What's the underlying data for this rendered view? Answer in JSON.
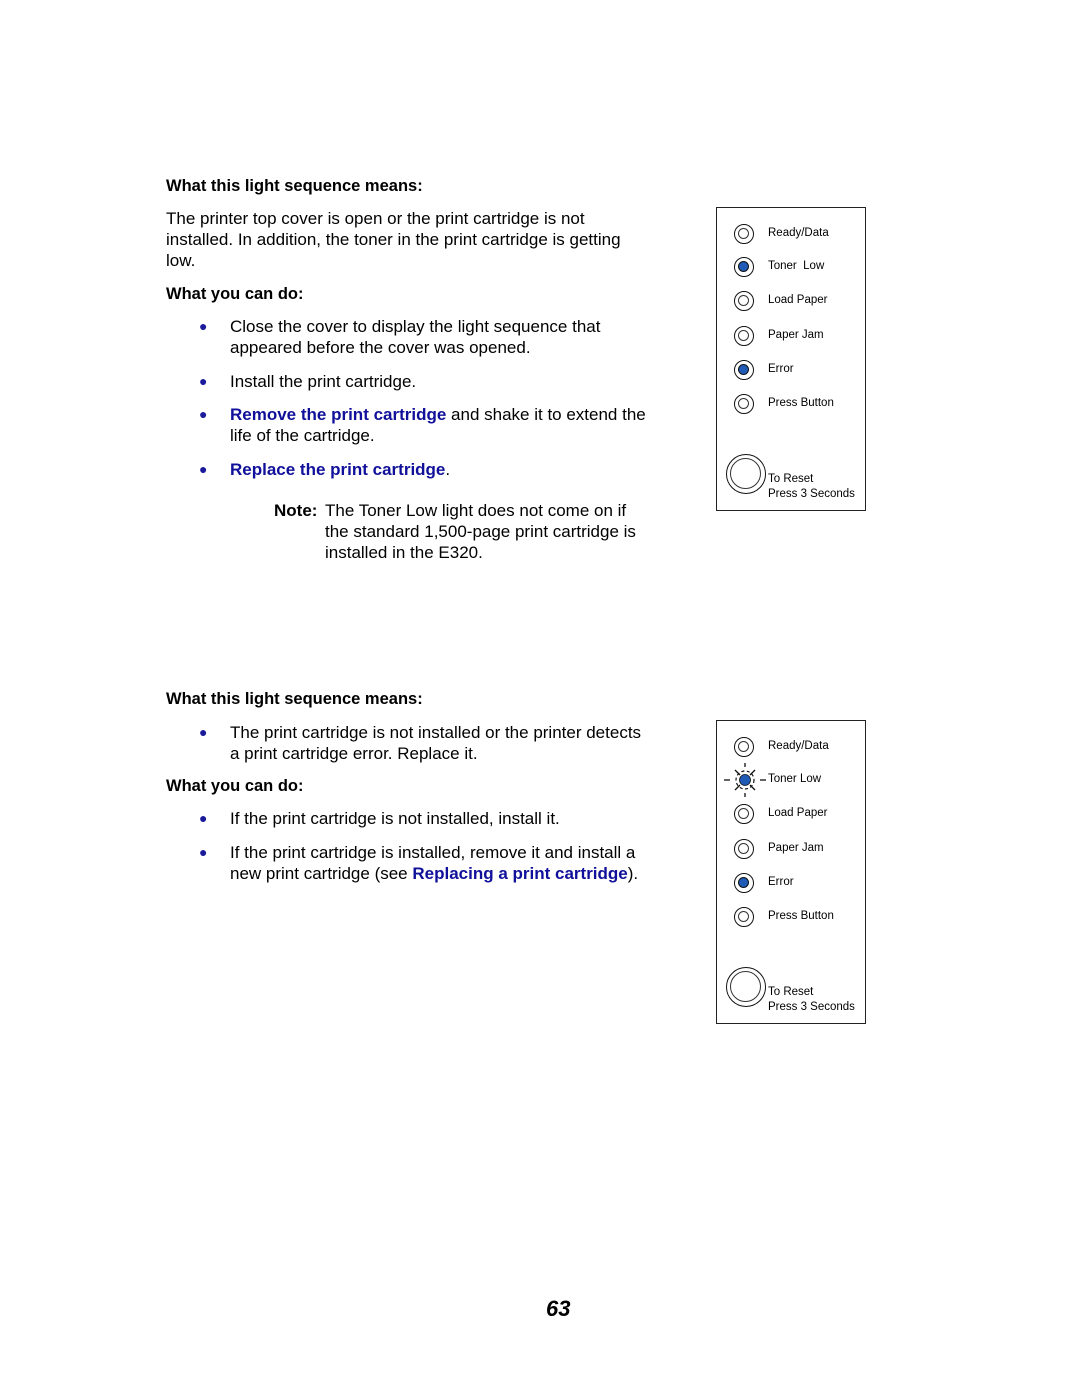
{
  "section1": {
    "heading_means": "What this light sequence means:",
    "description": "The printer top cover is open or the print cartridge is not installed. In addition, the toner in the print cartridge is getting low.",
    "heading_do": "What you can do:",
    "bullets": [
      {
        "text": "Close the cover to display the light sequence that appeared before the cover was opened."
      },
      {
        "text": "Install the print cartridge."
      },
      {
        "link": "Remove the print cartridge",
        "text": " and shake it to extend the life of the cartridge."
      },
      {
        "link": "Replace the print cartridge",
        "text": "."
      }
    ],
    "note_label": "Note:",
    "note_text": "The Toner Low light does not come on if the standard 1,500-page print cartridge is installed in the E320.",
    "panel": {
      "lights": [
        {
          "label": "Ready/Data",
          "state": "off"
        },
        {
          "label": "Toner  Low",
          "state": "on"
        },
        {
          "label": "Load Paper",
          "state": "off"
        },
        {
          "label": "Paper Jam",
          "state": "off"
        },
        {
          "label": "Error",
          "state": "on"
        },
        {
          "label": "Press Button",
          "state": "off"
        }
      ],
      "reset_line1": "To Reset",
      "reset_line2": "Press 3 Seconds"
    }
  },
  "section2": {
    "heading_means": "What this light sequence means:",
    "means_bullets": [
      {
        "text": "The print cartridge is not installed or the printer detects a print cartridge error. Replace it."
      }
    ],
    "heading_do": "What you can do:",
    "bullets": [
      {
        "text": "If the print cartridge is not installed, install it."
      },
      {
        "text_before": "If the print cartridge is installed, remove it and install a new print cartridge (see ",
        "link": "Replacing a print cartridge",
        "text_after": ")."
      }
    ],
    "panel": {
      "lights": [
        {
          "label": "Ready/Data",
          "state": "off"
        },
        {
          "label": "Toner Low",
          "state": "blinking"
        },
        {
          "label": "Load Paper",
          "state": "off"
        },
        {
          "label": "Paper Jam",
          "state": "off"
        },
        {
          "label": "Error",
          "state": "on"
        },
        {
          "label": "Press Button",
          "state": "off"
        }
      ],
      "reset_line1": "To Reset",
      "reset_line2": "Press 3 Seconds"
    }
  },
  "page_number": "63",
  "colors": {
    "link": "#10109a",
    "led_on": "#1f5bb5",
    "bullet": "#1a1a9a"
  }
}
